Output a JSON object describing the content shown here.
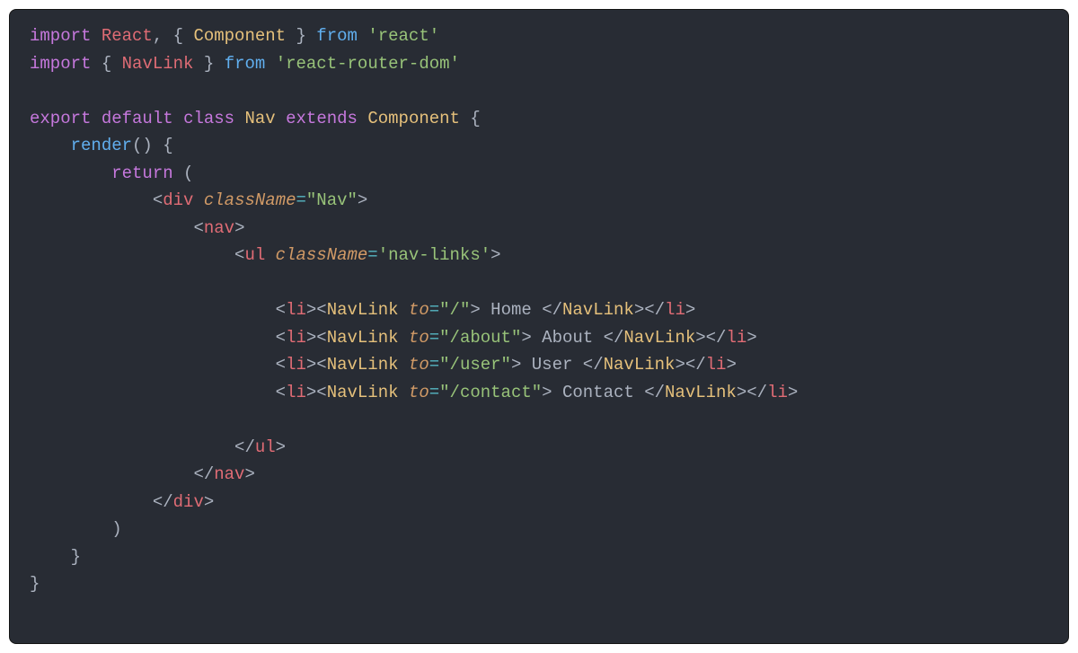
{
  "t": {
    "import1": "import",
    "React": "React",
    "comma1": ", { ",
    "Component": "Component",
    "closebr1": " } ",
    "from1": "from",
    "str_react": "'react'",
    "import2": "import",
    "openbr2": " { ",
    "NavLink": "NavLink",
    "closebr2": " } ",
    "from2": "from",
    "str_rrd": "'react-router-dom'",
    "export": "export",
    "default": "default",
    "class": "class",
    "Nav": "Nav",
    "extends": "extends",
    "Component2": "Component",
    "brace_open": " {",
    "render": "render",
    "paren_empty": "() {",
    "return": "return",
    "paren_open": " (",
    "lt": "<",
    "gt": ">",
    "slash": "/",
    "div": "div",
    "nav": "nav",
    "ul": "ul",
    "li": "li",
    "NavLinkTag": "NavLink",
    "className": "className",
    "to": "to",
    "eq": "=",
    "str_Nav": "\"Nav\"",
    "str_navlinks": "'nav-links'",
    "str_root": "\"/\"",
    "str_about": "\"/about\"",
    "str_user": "\"/user\"",
    "str_contact": "\"/contact\"",
    "txt_home": " Home ",
    "txt_about": " About ",
    "txt_user": " User ",
    "txt_contact": " Contact ",
    "paren_close": ")",
    "brace_close": "}",
    "sp1": " ",
    "ind1": "    ",
    "ind2": "        ",
    "ind3": "            ",
    "ind4": "                ",
    "ind5": "                    ",
    "ind6": "                        "
  }
}
